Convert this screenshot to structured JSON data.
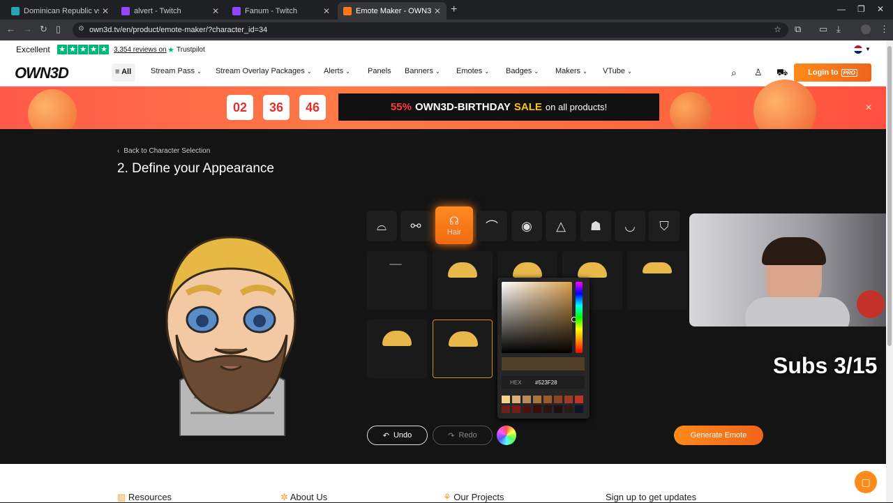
{
  "browser": {
    "tabs": [
      {
        "title": "Dominican Republic vs USA Live",
        "active": false,
        "favicon_color": "#2aa3b8"
      },
      {
        "title": "alvert - Twitch",
        "active": false,
        "favicon_color": "#9146ff"
      },
      {
        "title": "Fanum - Twitch",
        "active": false,
        "favicon_color": "#9146ff"
      },
      {
        "title": "Emote Maker - OWN3D",
        "active": true,
        "favicon_color": "#ff7a1a"
      }
    ],
    "url": "own3d.tv/en/product/emote-maker/?character_id=34"
  },
  "trustbar": {
    "rating_word": "Excellent",
    "reviews": "3,354 reviews on",
    "brand": "Trustpilot"
  },
  "nav": {
    "logo": "OWN3D",
    "all_label": "All",
    "items": [
      "Stream Pass",
      "Stream Overlay Packages",
      "Alerts",
      "Panels",
      "Banners",
      "Emotes",
      "Badges",
      "Makers",
      "VTube"
    ],
    "login_label": "Login to",
    "pro_badge": "PRO"
  },
  "banner": {
    "countdown": [
      "02",
      "36",
      "46"
    ],
    "sale_percent": "55%",
    "sale_text_1": "OWN3D-BIRTHDAY",
    "sale_word": "SALE",
    "sale_text_2": "on all products!"
  },
  "editor": {
    "back_label": "Back to Character Selection",
    "title": "2. Define your Appearance",
    "active_category": "Hair",
    "hex_label": "HEX",
    "hex_value": "#523F28",
    "selected_color": "#523F28",
    "undo_label": "Undo",
    "redo_label": "Redo",
    "generate_label": "Generate Emote",
    "swatches": [
      "#f4d28a",
      "#d9b07a",
      "#b88a5a",
      "#a8743f",
      "#9a5a2a",
      "#8a4320",
      "#a03a22",
      "#c03328",
      "#6e2018",
      "#7a1a16",
      "#4a1210",
      "#3a0c0c",
      "#2a1414",
      "#1e1010",
      "#2a1a18",
      "#10162a"
    ]
  },
  "overlay": {
    "subs_text": "Subs 3/15"
  },
  "footer": {
    "links": [
      "Resources",
      "About Us",
      "Our Projects",
      "Sign up to get updates"
    ]
  }
}
